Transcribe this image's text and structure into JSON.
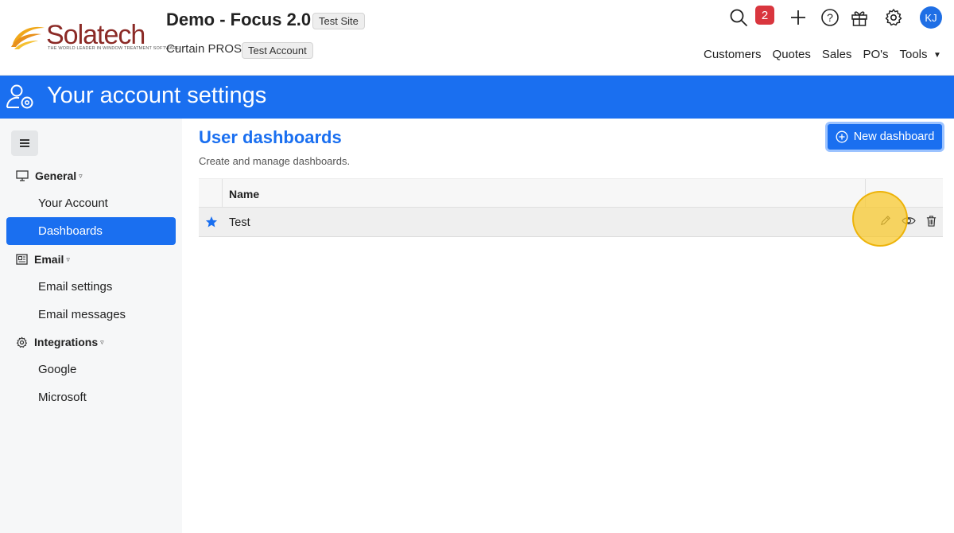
{
  "header": {
    "logo": {
      "word": "Solatech",
      "tagline": "The world leader in window treatment software"
    },
    "site_title": "Demo - Focus 2.0",
    "site_badge": "Test Site",
    "account_name": "Curtain PROS",
    "account_badge": "Test Account",
    "notification_count": "2",
    "avatar_initials": "KJ",
    "icons": [
      "search-icon",
      "plus-icon",
      "help-icon",
      "gift-icon",
      "gear-icon"
    ],
    "nav": [
      "Customers",
      "Quotes",
      "Sales",
      "PO's",
      "Tools"
    ],
    "tools_caret": "▼"
  },
  "banner": {
    "title": "Your account settings",
    "icon": "user-gear-icon",
    "color": "#1a6ff0"
  },
  "sidebar": {
    "sections": [
      {
        "label": "General",
        "icon": "monitor-icon",
        "items": [
          "Your Account",
          "Dashboards"
        ]
      },
      {
        "label": "Email",
        "icon": "newspaper-icon",
        "items": [
          "Email settings",
          "Email messages"
        ]
      },
      {
        "label": "Integrations",
        "icon": "gear-icon",
        "items": [
          "Google",
          "Microsoft"
        ]
      }
    ],
    "active_item": "Dashboards",
    "caret": "▿"
  },
  "main": {
    "title": "User dashboards",
    "subtitle": "Create and manage dashboards.",
    "new_button": "New dashboard",
    "table": {
      "columns": [
        "Name"
      ],
      "rows": [
        {
          "name": "Test",
          "favorite": true,
          "actions": [
            "edit-icon",
            "view-icon",
            "delete-icon"
          ]
        }
      ]
    }
  },
  "colors": {
    "accent": "#1a6ff0",
    "notification": "#d9363e",
    "highlight": "#f8c828"
  }
}
